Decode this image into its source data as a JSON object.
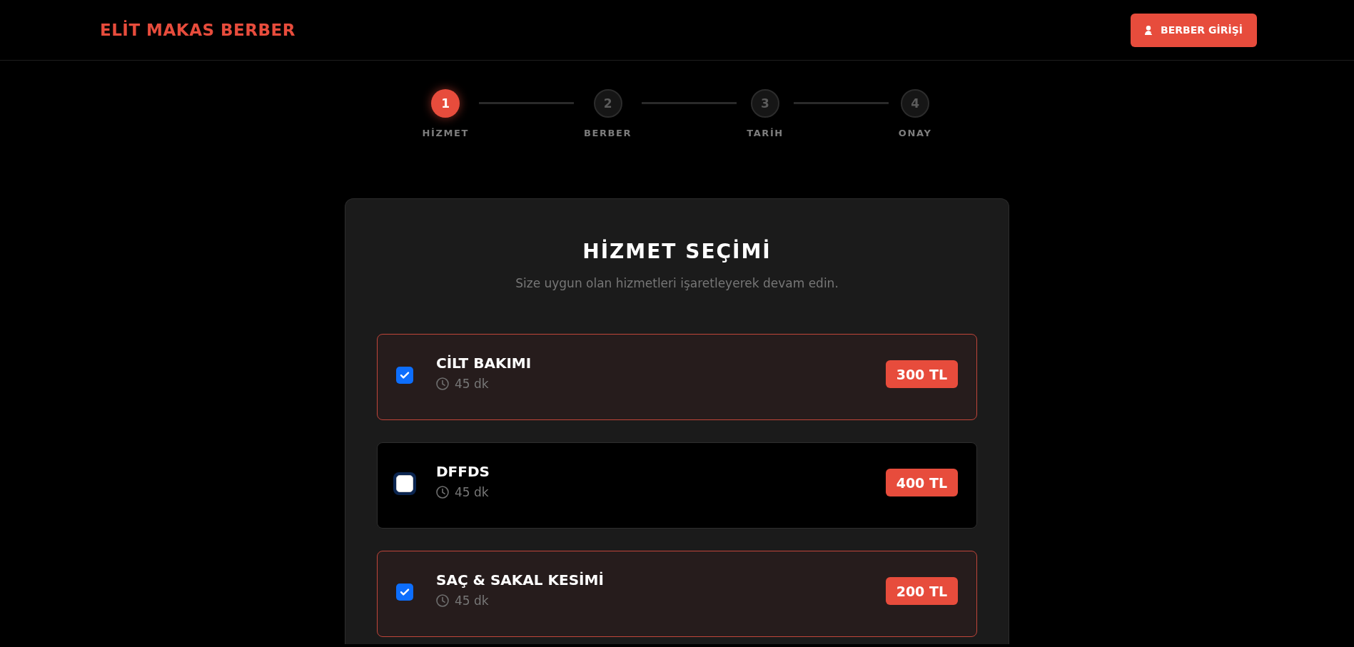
{
  "header": {
    "logo": "ELİT MAKAS BERBER",
    "login_button": "BERBER GİRİŞİ"
  },
  "steps": [
    {
      "number": "1",
      "label": "HİZMET",
      "selected": true
    },
    {
      "number": "2",
      "label": "BERBER",
      "selected": false
    },
    {
      "number": "3",
      "label": "TARİH",
      "selected": false
    },
    {
      "number": "4",
      "label": "ONAY",
      "selected": false
    }
  ],
  "service_panel": {
    "title": "HİZMET SEÇİMİ",
    "subtitle": "Size uygun olan hizmetleri işaretleyerek devam edin.",
    "services": [
      {
        "name": "CİLT BAKIMI",
        "duration": "45 dk",
        "price": "300 TL",
        "checked": true,
        "focused": false
      },
      {
        "name": "DFFDS",
        "duration": "45 dk",
        "price": "400 TL",
        "checked": false,
        "focused": true
      },
      {
        "name": "SAÇ & SAKAL KESİMİ",
        "duration": "45 dk",
        "price": "200 TL",
        "checked": true,
        "focused": false
      }
    ]
  }
}
